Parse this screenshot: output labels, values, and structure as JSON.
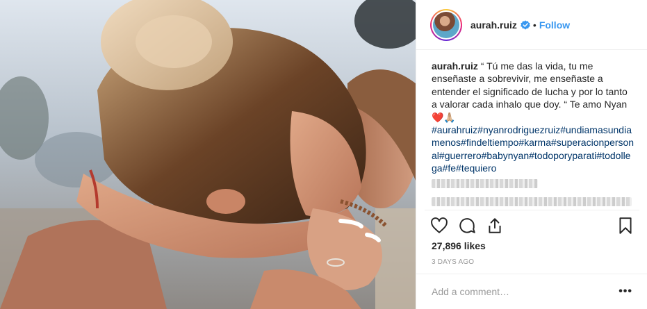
{
  "post": {
    "image_alt_subject": "",
    "author": {
      "username": "aurah.ruiz",
      "verified": true,
      "follow_label": "Follow",
      "separator": "•"
    },
    "caption": {
      "username": "aurah.ruiz",
      "text": "“ Tú me das la vida, tu me enseñaste a sobrevivir, me enseñaste a entender el significado de lucha y por lo tanto a valorar cada inhalo que doy. “ Te amo Nyan ❤️🙏🏼",
      "hashtags": [
        "#aurahruiz",
        "#nyanrodriguezruiz",
        "#undiamasun",
        "diamenos",
        "#findeltiempo",
        "#karma",
        "#superacion",
        "personal",
        "#guerrero",
        "#babynyan",
        "#todoporypara",
        "ti",
        "#todollega",
        "#fe",
        "#tequiero"
      ]
    },
    "actions": {
      "like_icon": "heart-icon",
      "comment_icon": "comment-icon",
      "share_icon": "share-icon",
      "save_icon": "bookmark-icon"
    },
    "likes_text": "27,896 likes",
    "date_text": "3 DAYS AGO",
    "comment_placeholder": "Add a comment…",
    "more_label": "•••"
  },
  "colors": {
    "link_blue": "#3897f0",
    "hashtag_blue": "#003569",
    "text": "#262626",
    "muted": "#999999",
    "border": "#efefef"
  }
}
